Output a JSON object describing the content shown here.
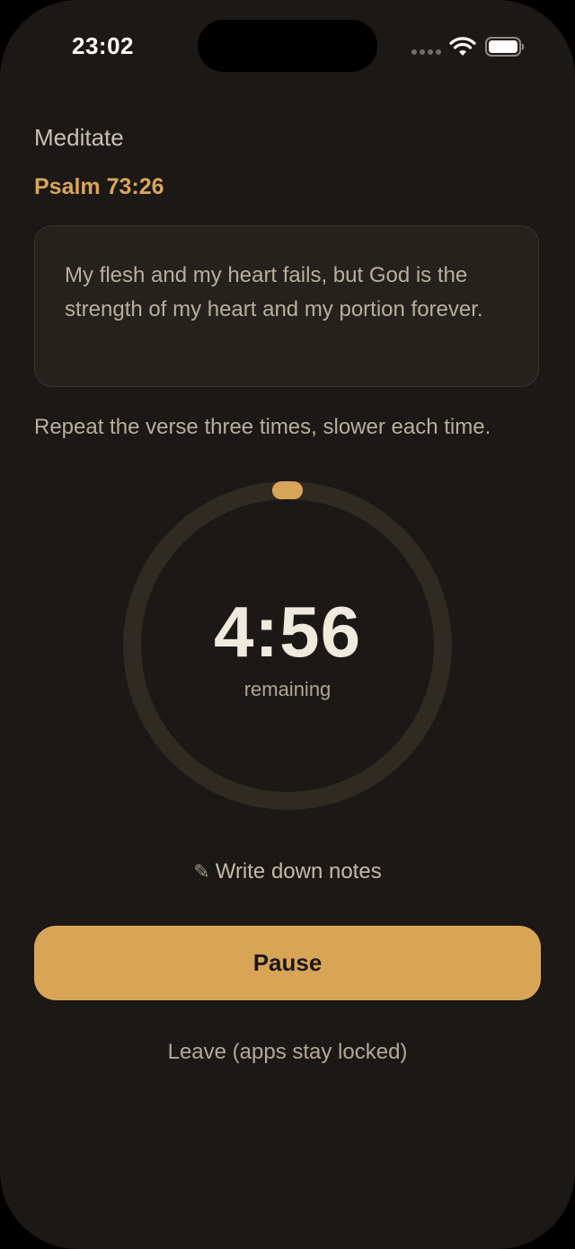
{
  "status_bar": {
    "time": "23:02",
    "icons": [
      "cellular-dots-icon",
      "wifi-icon",
      "battery-icon"
    ]
  },
  "screen": {
    "title": "Meditate",
    "verse_reference": "Psalm 73:26",
    "verse_text": "My flesh and my heart fails, but God is the strength of my heart and my portion forever.",
    "instruction": "Repeat the verse three times, slower each time."
  },
  "timer": {
    "value": "4:56",
    "label": "remaining",
    "progress": 0.013
  },
  "actions": {
    "notes_icon": "pencil-icon",
    "notes_label": "Write down notes",
    "pause_label": "Pause",
    "leave_label": "Leave (apps stay locked)"
  },
  "colors": {
    "background": "#1b1815",
    "accent": "#d8a557",
    "ring_track": "#2f2a22",
    "text_primary": "#f0e9de",
    "text_secondary": "#b8ae9f"
  }
}
